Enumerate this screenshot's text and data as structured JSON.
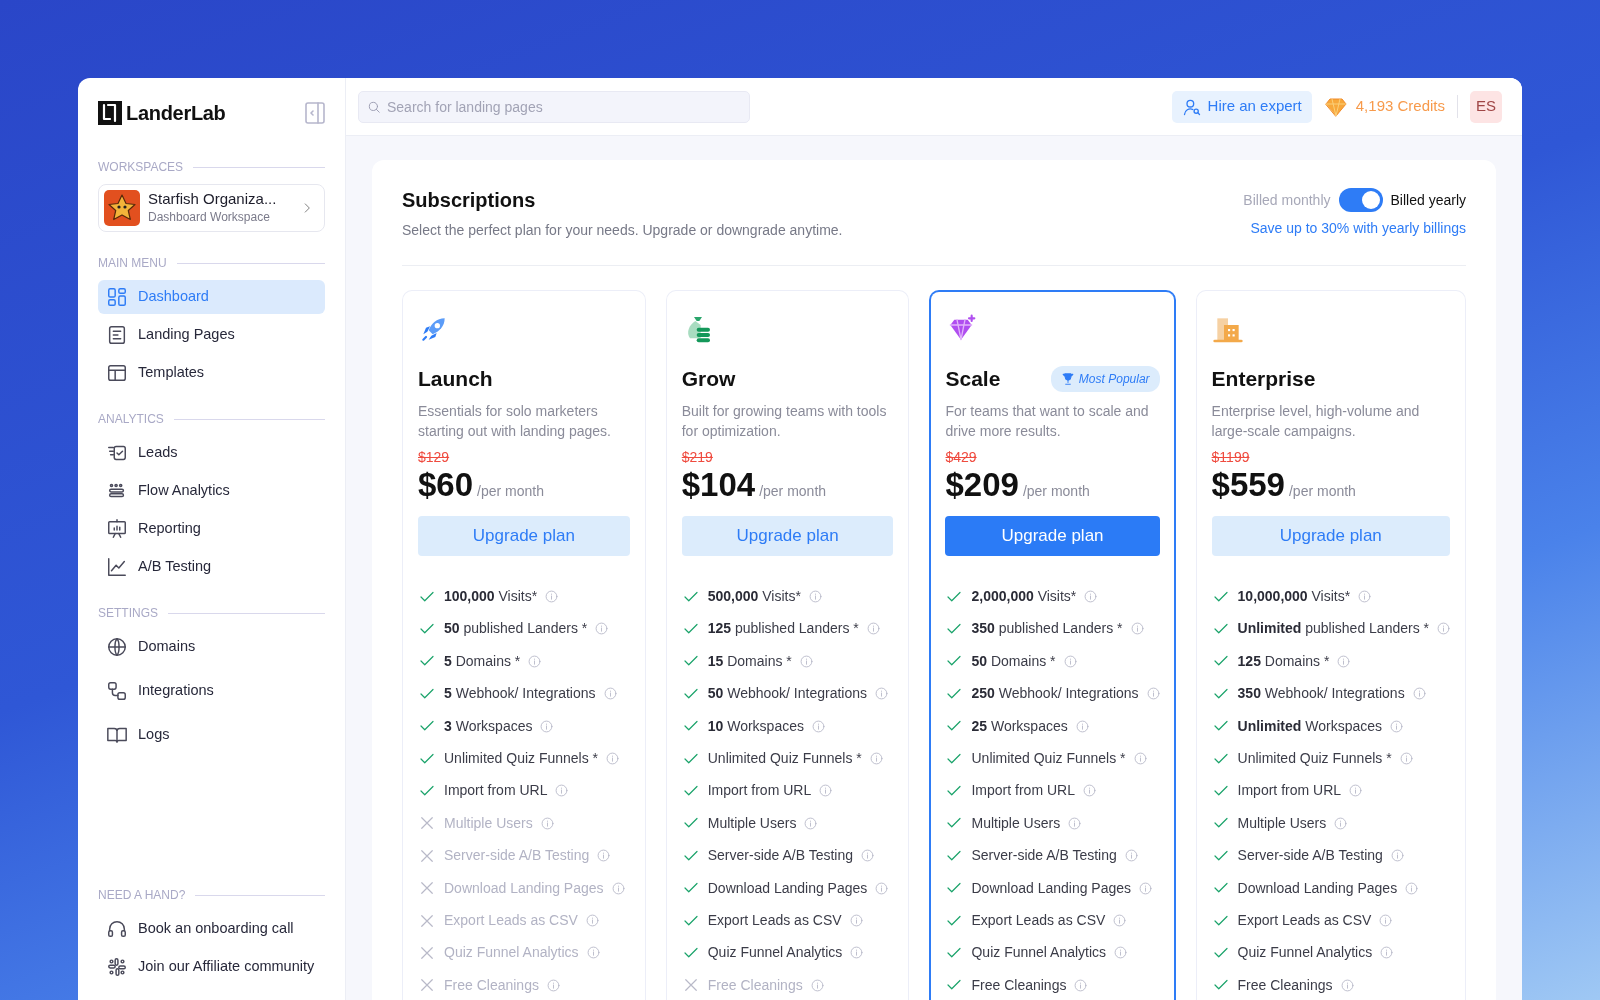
{
  "brand": {
    "name": "LanderLab"
  },
  "workspace": {
    "heading": "WORKSPACES",
    "name": "Starfish Organiza...",
    "subtitle": "Dashboard Workspace"
  },
  "sidebar": {
    "sections": [
      {
        "heading": "MAIN MENU",
        "items": [
          {
            "label": "Dashboard",
            "selected": true
          },
          {
            "label": "Landing Pages",
            "selected": false
          },
          {
            "label": "Templates",
            "selected": false
          }
        ]
      },
      {
        "heading": "ANALYTICS",
        "items": [
          {
            "label": "Leads",
            "selected": false
          },
          {
            "label": "Flow Analytics",
            "selected": false
          },
          {
            "label": "Reporting",
            "selected": false
          },
          {
            "label": "A/B Testing",
            "selected": false
          }
        ]
      },
      {
        "heading": "SETTINGS",
        "items": [
          {
            "label": "Domains",
            "selected": false
          },
          {
            "label": "Integrations",
            "selected": false
          },
          {
            "label": "Logs",
            "selected": false
          }
        ]
      }
    ],
    "help": {
      "heading": "NEED A HAND?",
      "items": [
        {
          "label": "Book an onboarding call"
        },
        {
          "label": "Join our Affiliate community"
        }
      ]
    }
  },
  "topbar": {
    "search": {
      "placeholder": "Search for landing pages"
    },
    "hire_button": "Hire an expert",
    "credits": "4,193 Credits",
    "avatar": "ES"
  },
  "subscriptions": {
    "title": "Subscriptions",
    "subtitle": "Select the perfect plan for your needs. Upgrade or downgrade anytime.",
    "billing": {
      "monthly_label": "Billed monthly",
      "yearly_label": "Billed yearly",
      "yearly": true,
      "note": "Save up to 30% with yearly billings"
    },
    "plans": [
      {
        "name": "Launch",
        "description": "Essentials for solo marketers starting out with landing pages.",
        "old_price": "$129",
        "price": "$60",
        "period": "/per month",
        "button": "Upgrade plan",
        "highlighted": false,
        "features": [
          {
            "text": "**100,000** Visits*",
            "included": true
          },
          {
            "text": "**50** published Landers *",
            "included": true
          },
          {
            "text": "**5** Domains *",
            "included": true
          },
          {
            "text": "**5** Webhook/ Integrations",
            "included": true
          },
          {
            "text": "**3** Workspaces",
            "included": true
          },
          {
            "text": "Unlimited Quiz Funnels *",
            "included": true
          },
          {
            "text": "Import from URL",
            "included": true
          },
          {
            "text": "Multiple Users",
            "included": false
          },
          {
            "text": "Server-side A/B Testing",
            "included": false
          },
          {
            "text": "Download Landing Pages",
            "included": false
          },
          {
            "text": "Export Leads as CSV",
            "included": false
          },
          {
            "text": "Quiz Funnel Analytics",
            "included": false
          },
          {
            "text": "Free Cleanings",
            "included": false
          }
        ]
      },
      {
        "name": "Grow",
        "description": "Built for growing teams with tools for optimization.",
        "old_price": "$219",
        "price": "$104",
        "period": "/per month",
        "button": "Upgrade plan",
        "highlighted": false,
        "features": [
          {
            "text": "**500,000** Visits*",
            "included": true
          },
          {
            "text": "**125** published Landers *",
            "included": true
          },
          {
            "text": "**15** Domains *",
            "included": true
          },
          {
            "text": "**50** Webhook/ Integrations",
            "included": true
          },
          {
            "text": "**10** Workspaces",
            "included": true
          },
          {
            "text": "Unlimited Quiz Funnels *",
            "included": true
          },
          {
            "text": "Import from URL",
            "included": true
          },
          {
            "text": "Multiple Users",
            "included": true
          },
          {
            "text": "Server-side A/B Testing",
            "included": true
          },
          {
            "text": "Download Landing Pages",
            "included": true
          },
          {
            "text": "Export Leads as CSV",
            "included": true
          },
          {
            "text": "Quiz Funnel Analytics",
            "included": true
          },
          {
            "text": "Free Cleanings",
            "included": false
          }
        ]
      },
      {
        "name": "Scale",
        "badge": "Most Popular",
        "description": "For teams that want to scale and drive more results.",
        "old_price": "$429",
        "price": "$209",
        "period": "/per month",
        "button": "Upgrade plan",
        "highlighted": true,
        "features": [
          {
            "text": "**2,000,000** Visits*",
            "included": true
          },
          {
            "text": "**350** published Landers *",
            "included": true
          },
          {
            "text": "**50** Domains *",
            "included": true
          },
          {
            "text": "**250** Webhook/ Integrations",
            "included": true
          },
          {
            "text": "**25** Workspaces",
            "included": true
          },
          {
            "text": "Unlimited Quiz Funnels *",
            "included": true
          },
          {
            "text": "Import from URL",
            "included": true
          },
          {
            "text": "Multiple Users",
            "included": true
          },
          {
            "text": "Server-side A/B Testing",
            "included": true
          },
          {
            "text": "Download Landing Pages",
            "included": true
          },
          {
            "text": "Export Leads as CSV",
            "included": true
          },
          {
            "text": "Quiz Funnel Analytics",
            "included": true
          },
          {
            "text": "Free Cleanings",
            "included": true
          }
        ]
      },
      {
        "name": "Enterprise",
        "description": "Enterprise level, high-volume and large-scale campaigns.",
        "old_price": "$1199",
        "price": "$559",
        "period": "/per month",
        "button": "Upgrade plan",
        "highlighted": false,
        "features": [
          {
            "text": "**10,000,000** Visits*",
            "included": true
          },
          {
            "text": "**Unlimited** published Landers *",
            "included": true
          },
          {
            "text": "**125** Domains *",
            "included": true
          },
          {
            "text": "**350** Webhook/ Integrations",
            "included": true
          },
          {
            "text": "**Unlimited** Workspaces",
            "included": true
          },
          {
            "text": "Unlimited Quiz Funnels *",
            "included": true
          },
          {
            "text": "Import from URL",
            "included": true
          },
          {
            "text": "Multiple Users",
            "included": true
          },
          {
            "text": "Server-side A/B Testing",
            "included": true
          },
          {
            "text": "Download Landing Pages",
            "included": true
          },
          {
            "text": "Export Leads as CSV",
            "included": true
          },
          {
            "text": "Quiz Funnel Analytics",
            "included": true
          },
          {
            "text": "Free Cleanings",
            "included": true
          }
        ]
      }
    ]
  }
}
